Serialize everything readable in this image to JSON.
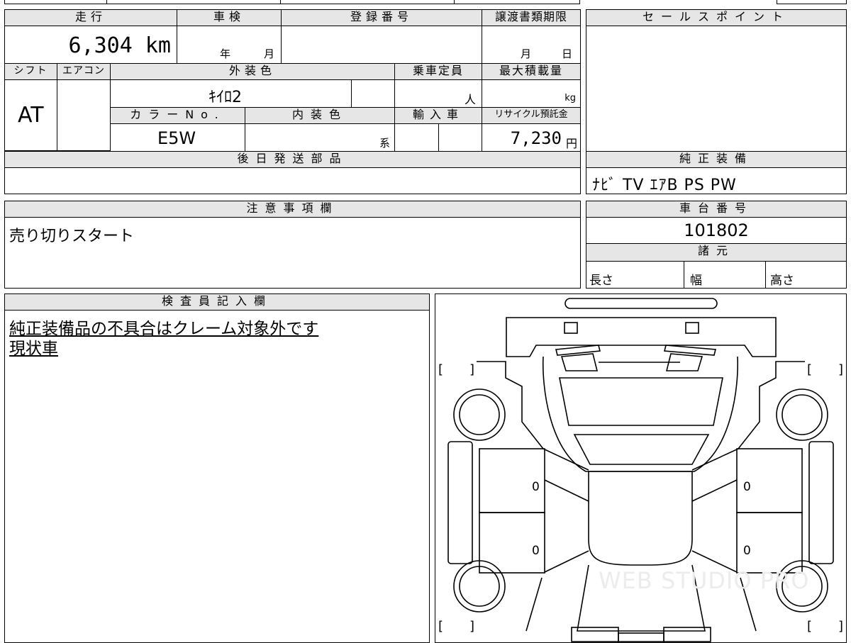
{
  "mileage": {
    "label": "走行",
    "value": "6,304 km"
  },
  "inspection": {
    "label": "車検",
    "year_unit": "年",
    "month_unit": "月"
  },
  "registration": {
    "label": "登録番号"
  },
  "transfer_deadline": {
    "label": "譲渡書類期限",
    "month_unit": "月",
    "day_unit": "日"
  },
  "sales_points": {
    "label": "セールスポイント"
  },
  "shift": {
    "label": "シフト",
    "value": "AT"
  },
  "aircon": {
    "label": "エアコン"
  },
  "exterior_color": {
    "label": "外装色",
    "value": "ｷｲﾛ2"
  },
  "capacity": {
    "label": "乗車定員",
    "unit": "人"
  },
  "max_load": {
    "label": "最大積載量",
    "unit": "kg"
  },
  "color_no": {
    "label": "カラーNo.",
    "value": "E5W"
  },
  "interior_color": {
    "label": "内装色",
    "suffix": "系"
  },
  "import_car": {
    "label": "輸入車"
  },
  "recycle_fee": {
    "label": "リサイクル預託金",
    "value": "7,230",
    "unit": "円"
  },
  "shipping_parts": {
    "label": "後日発送部品"
  },
  "genuine_equipment": {
    "label": "純正装備",
    "value": "ﾅﾋﾞ TV ｴｱB PS PW"
  },
  "notes": {
    "label": "注意事項欄",
    "value": "売り切りスタート"
  },
  "chassis_number": {
    "label": "車台番号",
    "value": "101802"
  },
  "specs": {
    "label": "諸元",
    "length": "長さ",
    "width": "幅",
    "height": "高さ"
  },
  "inspector": {
    "label": "検査員記入欄",
    "lines": [
      "純正装備品の不具合はクレーム対象外です",
      "現状車"
    ]
  },
  "diagram": {
    "left_mark": "0",
    "right_mark": "0",
    "left_mark2": "0",
    "right_mark2": "0",
    "bracket_open": "[",
    "bracket_close": "]",
    "watermark": "WEB STUDIO PRO"
  }
}
